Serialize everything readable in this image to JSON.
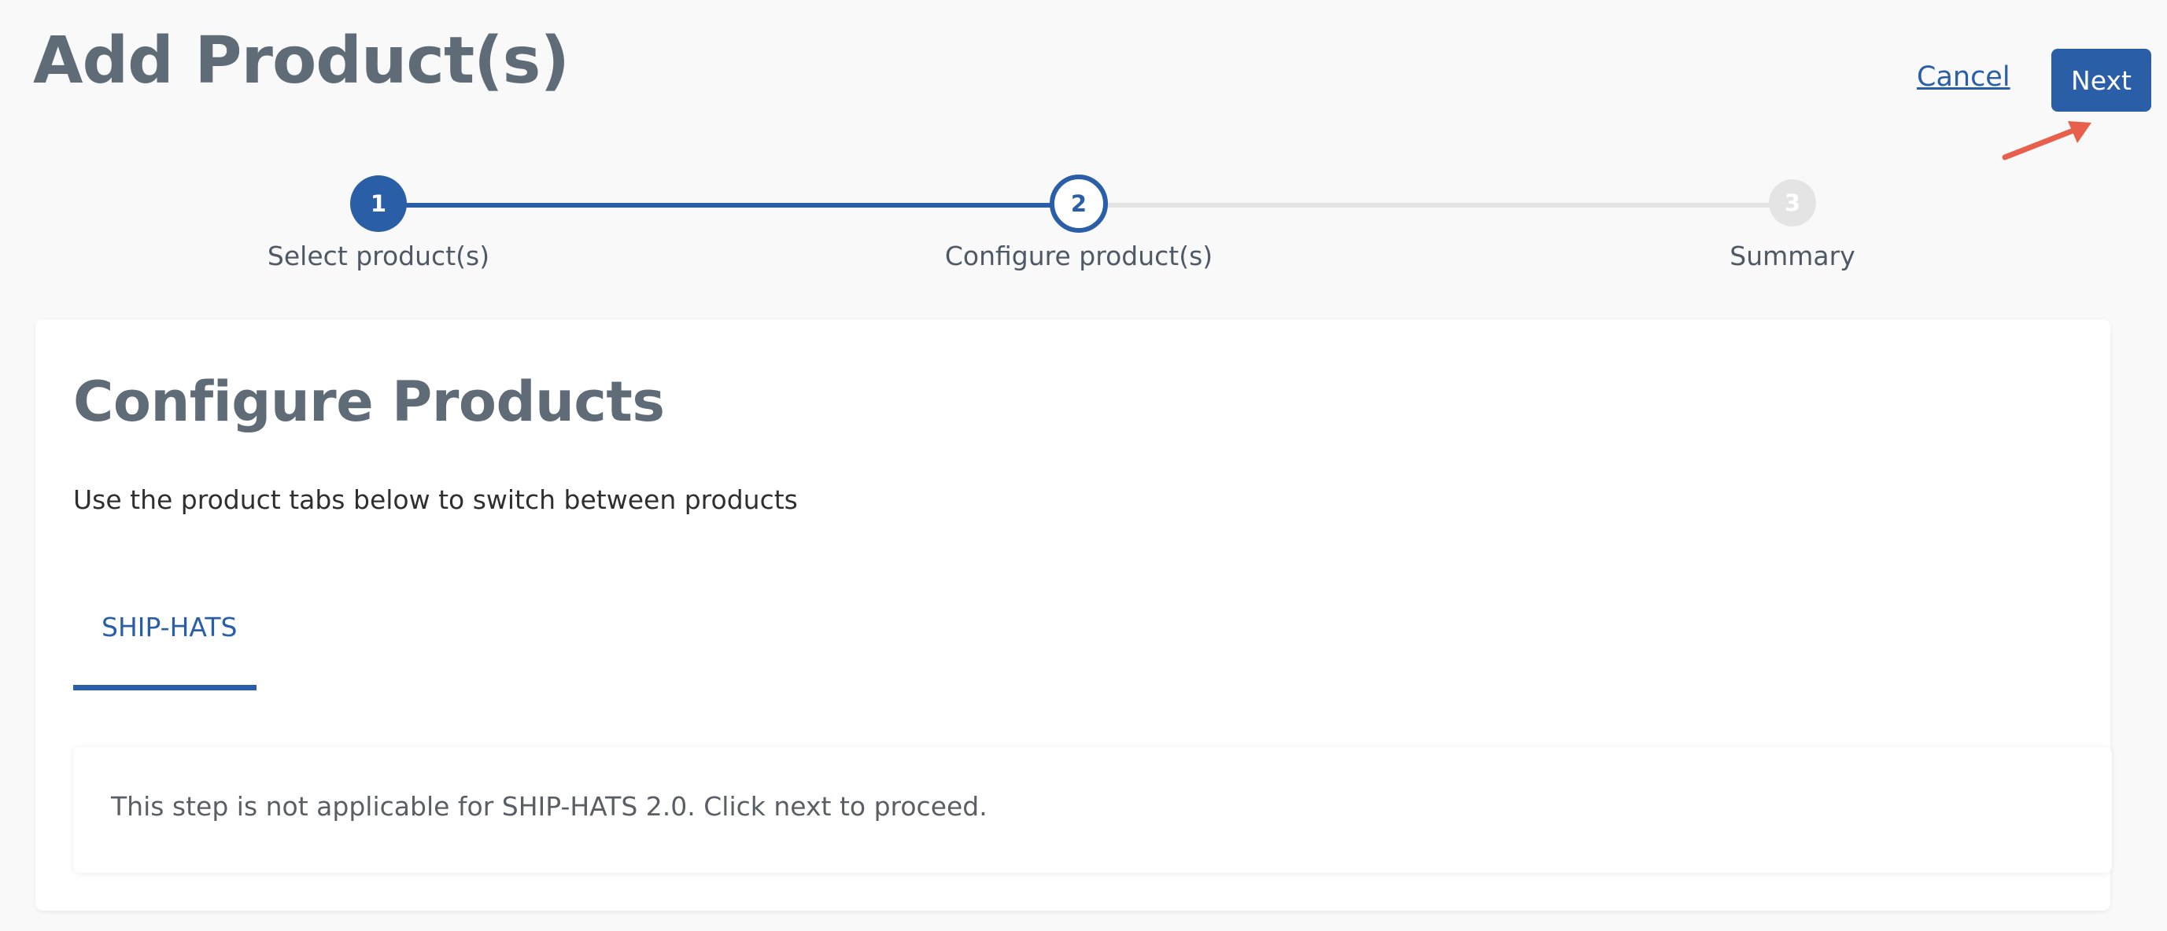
{
  "header": {
    "title": "Add Product(s)",
    "cancel_label": "Cancel",
    "next_label": "Next"
  },
  "stepper": {
    "steps": [
      {
        "number": "1",
        "label": "Select product(s)",
        "state": "completed"
      },
      {
        "number": "2",
        "label": "Configure product(s)",
        "state": "current"
      },
      {
        "number": "3",
        "label": "Summary",
        "state": "upcoming"
      }
    ]
  },
  "main": {
    "title": "Configure Products",
    "subtitle": "Use the product tabs below to switch between products",
    "tabs": [
      {
        "label": "SHIP-HATS",
        "active": true
      }
    ],
    "notice": "This step is not applicable for SHIP-HATS 2.0. Click next to proceed."
  },
  "colors": {
    "primary": "#2a5ea6",
    "title_gray": "#5f6b76",
    "inactive_step": "#e4e4e4",
    "annotation_arrow": "#e8604c"
  }
}
